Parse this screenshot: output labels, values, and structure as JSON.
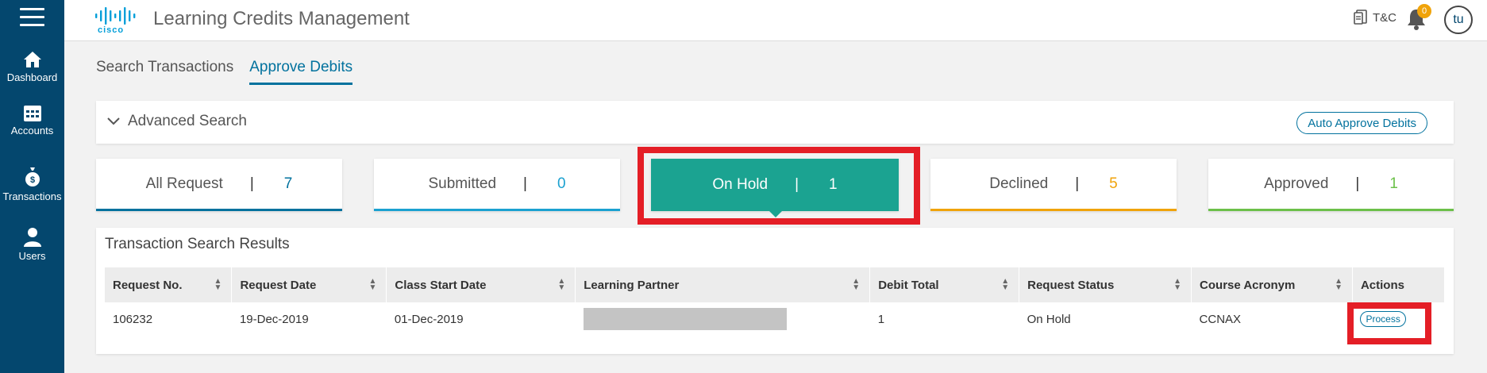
{
  "app": {
    "title": "Learning Credits Management",
    "brand": "cisco",
    "tc_label": "T&C",
    "notification_count": "0",
    "avatar_initials": "tu"
  },
  "sidebar": {
    "items": [
      {
        "label": "Dashboard",
        "icon": "home-icon"
      },
      {
        "label": "Accounts",
        "icon": "calendar-grid-icon"
      },
      {
        "label": "Transactions",
        "icon": "money-bag-icon"
      },
      {
        "label": "Users",
        "icon": "user-icon"
      }
    ]
  },
  "tabs": [
    {
      "label": "Search Transactions",
      "active": false
    },
    {
      "label": "Approve Debits",
      "active": true
    }
  ],
  "advanced_search": {
    "label": "Advanced Search",
    "auto_approve_label": "Auto Approve Debits"
  },
  "status_cards": [
    {
      "label": "All Request",
      "separator": "|",
      "count": "7",
      "color": "#02729e"
    },
    {
      "label": "Submitted",
      "separator": "|",
      "count": "0",
      "color": "#1ba1d0"
    },
    {
      "label": "On Hold",
      "separator": "|",
      "count": "1",
      "color": "#1ba391",
      "active": true
    },
    {
      "label": "Declined",
      "separator": "|",
      "count": "5",
      "color": "#f0a30a"
    },
    {
      "label": "Approved",
      "separator": "|",
      "count": "1",
      "color": "#6cc04a"
    }
  ],
  "results": {
    "title": "Transaction Search Results",
    "columns": [
      "Request No.",
      "Request Date",
      "Class Start Date",
      "Learning Partner",
      "Debit Total",
      "Request Status",
      "Course Acronym",
      "Actions"
    ],
    "rows": [
      {
        "request_no": "106232",
        "request_date": "19-Dec-2019",
        "class_start_date": "01-Dec-2019",
        "learning_partner": "",
        "debit_total": "1",
        "request_status": "On Hold",
        "course_acronym": "CCNAX",
        "action_label": "Process"
      }
    ]
  },
  "colors": {
    "sidebar_bg": "#04476e",
    "accent": "#02729e",
    "on_hold": "#1ba391",
    "highlight": "#e41e26"
  }
}
